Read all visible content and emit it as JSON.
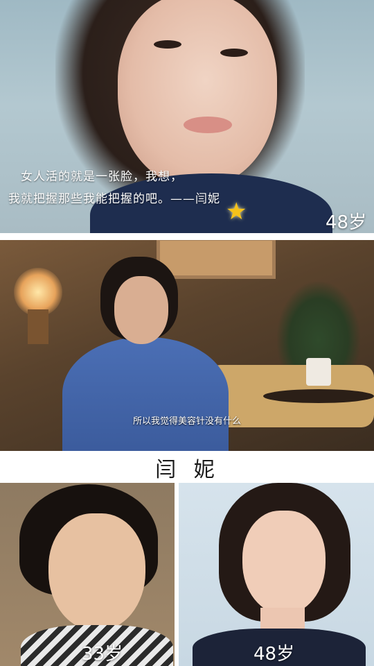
{
  "panel_top": {
    "quote_line1": "女人活的就是一张脸，我想，",
    "quote_line2": "我就把握那些我能把握的吧。——闫妮",
    "age": "48岁",
    "accent": "#f6c21a"
  },
  "panel_middle": {
    "subtitle": "所以我觉得美容针没有什么"
  },
  "panel_bottom": {
    "name": "闫 妮",
    "left_age": "33岁",
    "right_age": "48岁"
  }
}
